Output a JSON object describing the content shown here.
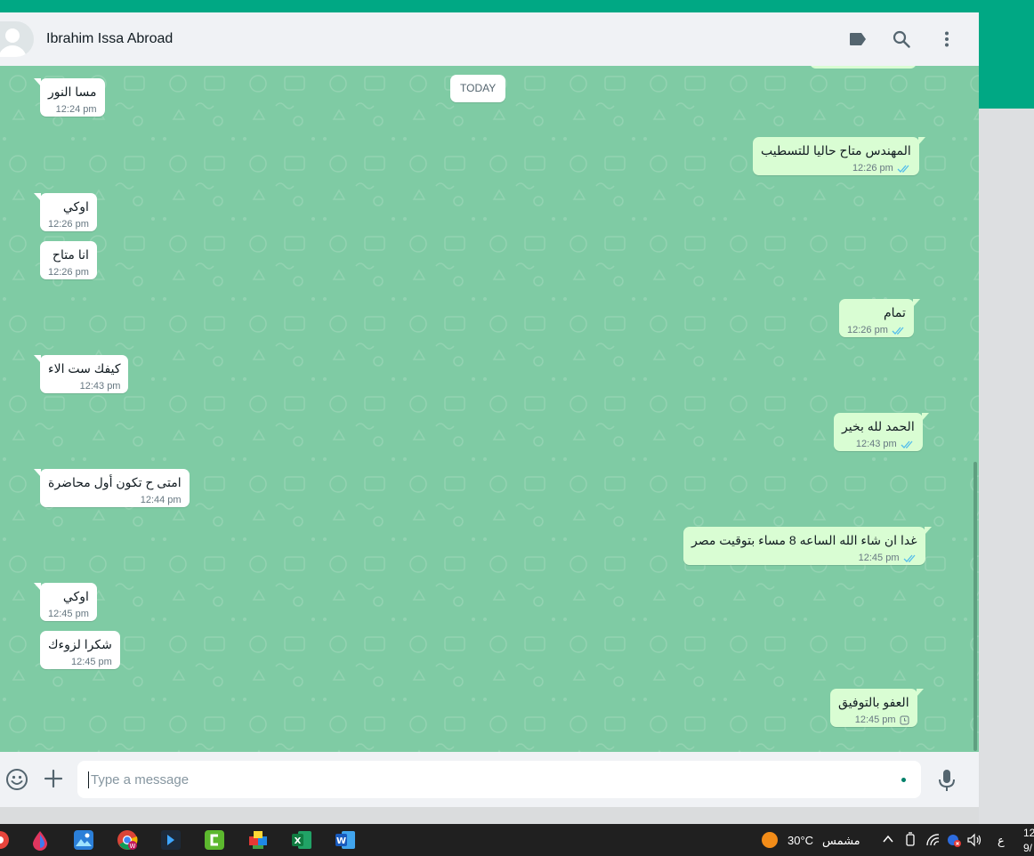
{
  "header": {
    "contact_name": "Ibrahim Issa Abroad",
    "icons": [
      "label-icon",
      "search-icon",
      "menu-icon"
    ]
  },
  "chat": {
    "date_divider": "TODAY",
    "messages": [
      {
        "dir": "in",
        "text": "مسا النور",
        "time": "12:24 pm"
      },
      {
        "dir": "out",
        "text": "المهندس متاح حاليا للتسطيب",
        "time": "12:26 pm",
        "status": "read"
      },
      {
        "dir": "in",
        "text": "اوكي",
        "time": "12:26 pm"
      },
      {
        "dir": "in",
        "text": "انا متاح",
        "time": "12:26 pm"
      },
      {
        "dir": "out",
        "text": "تمام",
        "time": "12:26 pm",
        "status": "read"
      },
      {
        "dir": "in",
        "text": "كيفك ست الاء",
        "time": "12:43 pm"
      },
      {
        "dir": "out",
        "text": "الحمد لله بخير",
        "time": "12:43 pm",
        "status": "read"
      },
      {
        "dir": "in",
        "text": "امتى ح تكون أول محاضرة",
        "time": "12:44 pm"
      },
      {
        "dir": "out",
        "text": "غدا ان شاء الله الساعه 8 مساء بتوقيت مصر",
        "time": "12:45 pm",
        "status": "read"
      },
      {
        "dir": "in",
        "text": "اوكي",
        "time": "12:45 pm"
      },
      {
        "dir": "in",
        "text": "شكرا لزوءك",
        "time": "12:45 pm"
      },
      {
        "dir": "out",
        "text": "العفو بالتوفيق",
        "time": "12:45 pm",
        "status": "pending"
      }
    ]
  },
  "composer": {
    "placeholder": "Type a message"
  },
  "taskbar": {
    "weather_temp": "30°C",
    "weather_text": "مشمس",
    "input_lang": "ع",
    "clock_time": "12",
    "clock_date": "9/"
  },
  "colors": {
    "accent": "#00a884",
    "chat_bg": "#7fcba4",
    "outgoing_bubble": "#d9fdd3",
    "incoming_bubble": "#ffffff",
    "read_tick": "#53bdeb"
  }
}
